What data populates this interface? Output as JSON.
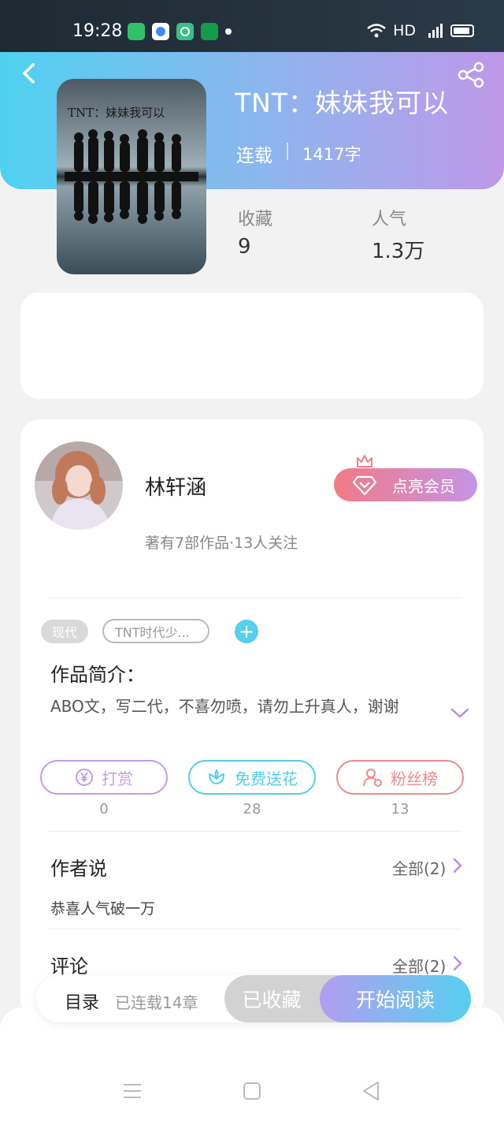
{
  "status_bar": {
    "time": "19:28",
    "network": "HD",
    "app_icon_colors": [
      "#2ec26a",
      "#3b8df5",
      "#39c08a",
      "#139c49"
    ]
  },
  "book": {
    "cover_text": "TNT：妹妹我可以",
    "title": "TNT：妹妹我可以",
    "status": "连载",
    "word_count": "1417字",
    "stats": [
      {
        "label": "收藏",
        "value": "9"
      },
      {
        "label": "人气",
        "value": "1.3万"
      }
    ]
  },
  "author": {
    "name": "林轩涵",
    "meta": "著有7部作品·13人关注",
    "vip_label": "点亮会员"
  },
  "tags": {
    "genre": "现代",
    "custom": "TNT时代少...",
    "add": "+"
  },
  "intro": {
    "heading": "作品简介：",
    "text": "ABO文，写二代，不喜勿喷，请勿上升真人，谢谢"
  },
  "actions": [
    {
      "label": "打赏",
      "count": "0",
      "icon": "yen-coin-icon",
      "color": "#c49be8"
    },
    {
      "label": "免费送花",
      "count": "28",
      "icon": "flower-icon",
      "color": "#4fcfe6"
    },
    {
      "label": "粉丝榜",
      "count": "13",
      "icon": "fan-ranking-icon",
      "color": "#ef8a8a"
    }
  ],
  "author_says": {
    "heading": "作者说",
    "all_label": "全部(2)",
    "note": "恭喜人气破一万"
  },
  "comments": {
    "heading": "评论",
    "all_label": "全部(2)"
  },
  "action_bar": {
    "toc_label": "目录",
    "chapter_count": "已连载14章",
    "favorite_label": "已收藏",
    "read_label": "开始阅读"
  },
  "colors": {
    "header_gradient_start": "#4fd1f0",
    "header_gradient_end": "#bf98e8",
    "accent_purple": "#b88de6",
    "accent_cyan": "#56cff0"
  }
}
